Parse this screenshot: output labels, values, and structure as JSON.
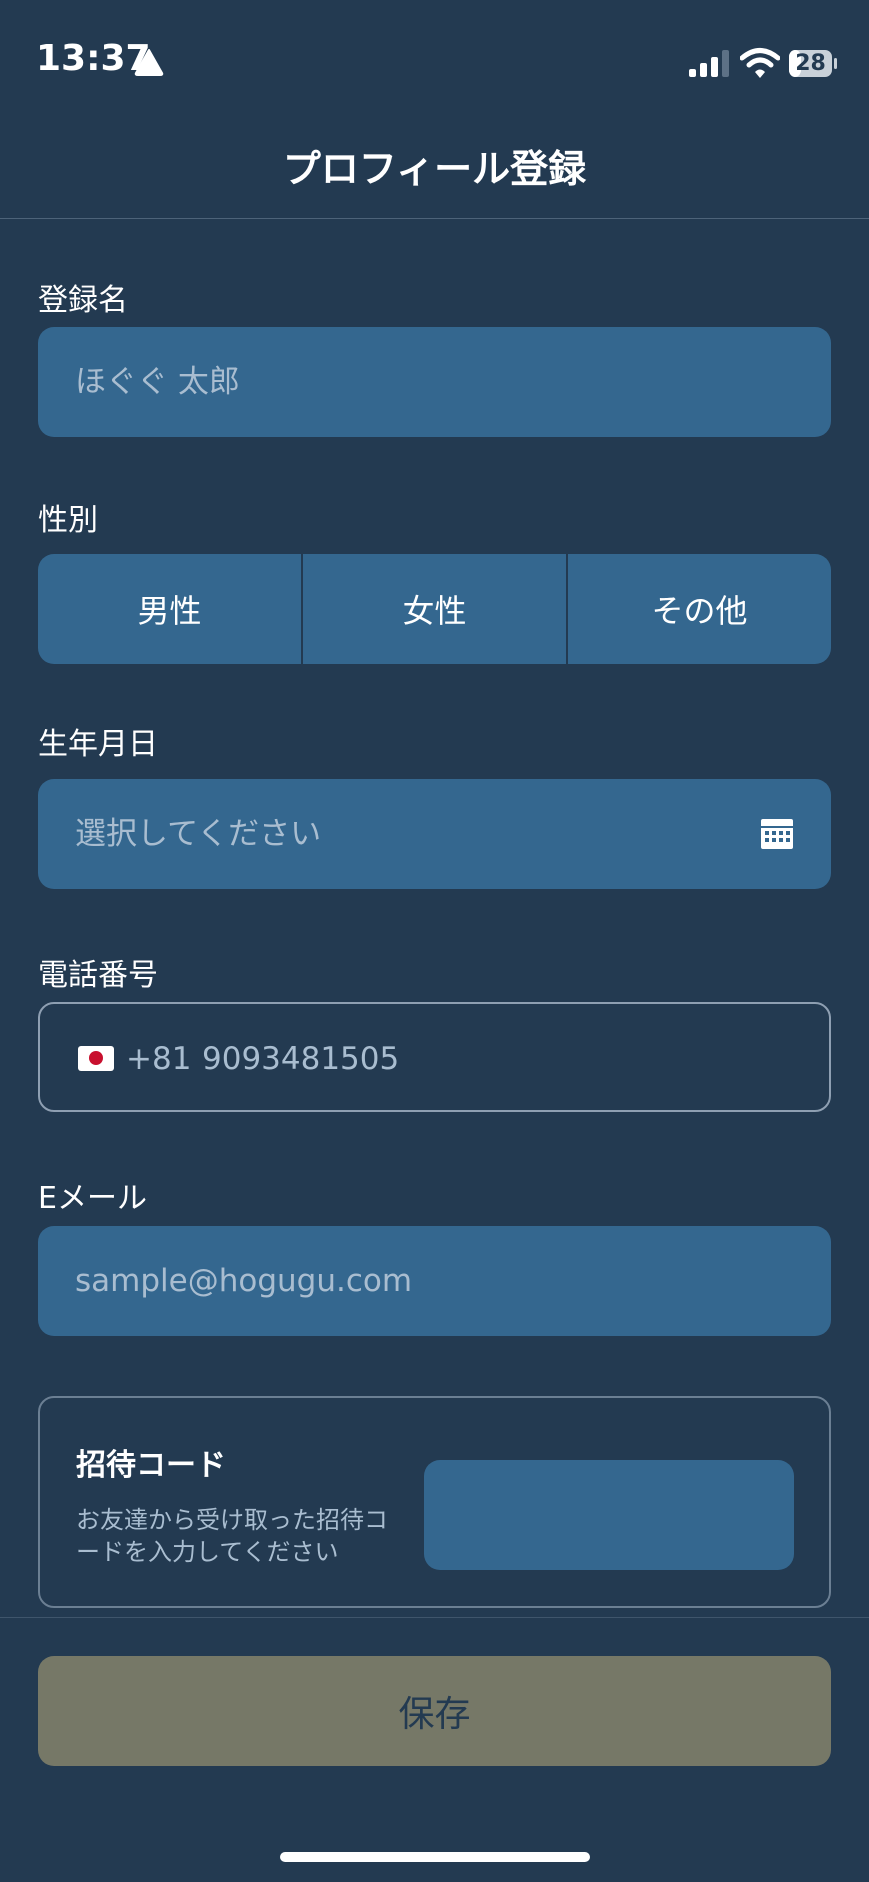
{
  "status_bar": {
    "time": "13:37",
    "battery": "28",
    "icons": [
      "warning-triangle-icon",
      "cellular-signal-icon",
      "wifi-icon",
      "battery-icon"
    ]
  },
  "header": {
    "title": "プロフィール登録"
  },
  "form": {
    "name": {
      "label": "登録名",
      "placeholder": "ほぐぐ 太郎"
    },
    "gender": {
      "label": "性別",
      "options": [
        "男性",
        "女性",
        "その他"
      ]
    },
    "birthdate": {
      "label": "生年月日",
      "placeholder": "選択してください",
      "icon": "calendar-icon"
    },
    "phone": {
      "label": "電話番号",
      "flag": "japan-flag-icon",
      "country_code": "+81",
      "number": "9093481505"
    },
    "email": {
      "label": "Eメール",
      "placeholder": "sample@hogugu.com"
    },
    "invite": {
      "title": "招待コード",
      "description": "お友達から受け取った招待コードを入力してください",
      "value": ""
    }
  },
  "footer": {
    "save_label": "保存"
  },
  "colors": {
    "background": "#233a51",
    "field": "#34678f",
    "placeholder_text": "#a9bdd0",
    "save_button": "#767867"
  }
}
